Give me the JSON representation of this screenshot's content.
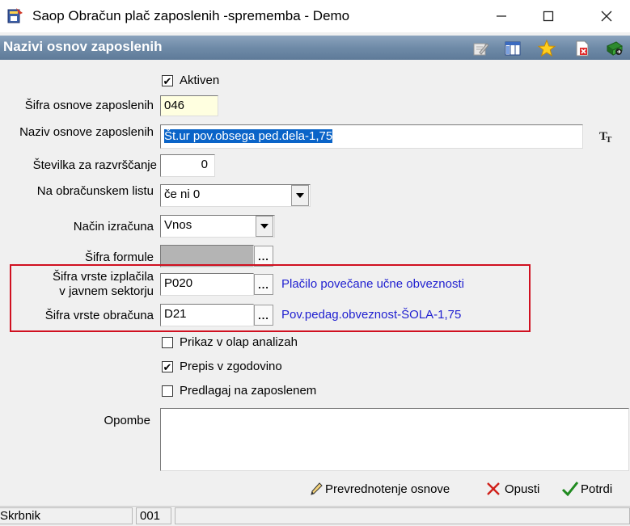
{
  "window": {
    "title": "Saop Obračun plač zaposlenih -sprememba - Demo",
    "minimize_glyph": "—",
    "maximize_glyph": "☐",
    "close_glyph": "✕"
  },
  "header": {
    "title": "Nazivi osnov zaposlenih",
    "toolbar_icons": [
      "edit-icon",
      "columns-icon",
      "star-icon",
      "delete-doc-icon",
      "exit-icon"
    ]
  },
  "form": {
    "aktiven": {
      "label": "Aktiven",
      "checked": true
    },
    "sifra_osnove": {
      "label": "Šifra osnove zaposlenih",
      "value": "046"
    },
    "naziv_osnove": {
      "label": "Naziv osnove zaposlenih",
      "value": "Št.ur pov.obsega ped.dela-1,75"
    },
    "stevilka": {
      "label": "Številka  za razvrščanje",
      "value": "0"
    },
    "na_obracunskem_listu": {
      "label": "Na obračunskem listu",
      "value": "če ni 0"
    },
    "nacin_izracuna": {
      "label": "Način izračuna",
      "value": "Vnos"
    },
    "sifra_formule": {
      "label": "Šifra formule",
      "value": ""
    },
    "sifra_vrste_izplacila": {
      "label_line1": "Šifra vrste izplačila",
      "label_line2": "v javnem sektorju",
      "value": "P020",
      "description": "Plačilo povečane učne obveznosti"
    },
    "sifra_vrste_obracuna": {
      "label": "Šifra vrste obračuna",
      "value": "D21",
      "description": "Pov.pedag.obveznost-ŠOLA-1,75"
    },
    "prikaz_olap": {
      "label": "Prikaz v olap analizah",
      "checked": false
    },
    "prepis_zgodovino": {
      "label": "Prepis v zgodovino",
      "checked": true
    },
    "predlagaj": {
      "label": "Predlagaj na zaposlenem",
      "checked": false
    },
    "opombe": {
      "label": "Opombe",
      "value": ""
    },
    "ellipsis": "..."
  },
  "buttons": {
    "prevrednotenje": "Prevrednotenje osnove",
    "opusti": "Opusti",
    "potrdi": "Potrdi"
  },
  "status": {
    "user": "Skrbnik",
    "code": "001",
    "message": ""
  },
  "colors": {
    "header_gradient": "#6f8ba8",
    "highlight_border": "#d01020",
    "link_blue": "#1f1fd0",
    "required_yellow": "#ffffe0"
  }
}
